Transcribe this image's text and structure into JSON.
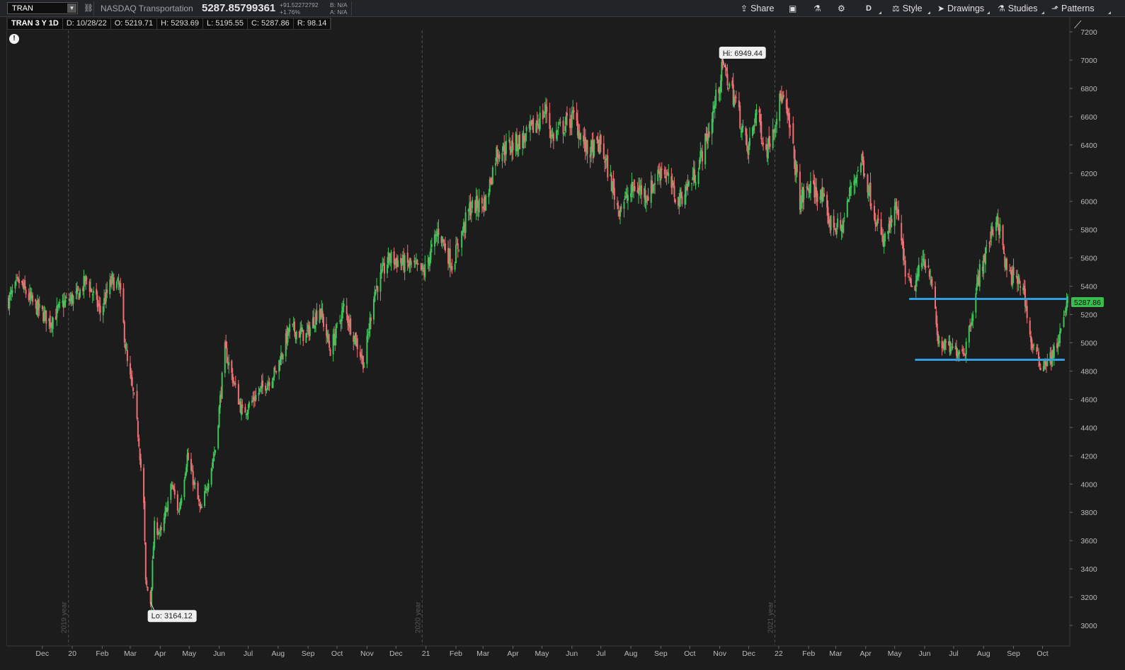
{
  "toolbar": {
    "symbol": "TRAN",
    "description": "NASDAQ Transportation",
    "last_price": "5287.85799361",
    "net_change": "+91.52272792",
    "pct_change": "+1.76%",
    "bid": "B: N/A",
    "ask": "A: N/A",
    "share_label": "Share",
    "aggregation_label": "D",
    "style_label": "Style",
    "drawings_label": "Drawings",
    "studies_label": "Studies",
    "patterns_label": "Patterns"
  },
  "infobar": {
    "symbol_period": "TRAN 3 Y 1D",
    "date": "D: 10/28/22",
    "open": "O: 5219.71",
    "high": "H: 5293.69",
    "low": "L: 5195.55",
    "close": "C: 5287.86",
    "range": "R: 98.14"
  },
  "colors": {
    "up": "#3ec45a",
    "down": "#ef6f74",
    "level_line": "#2f9fdf",
    "price_tag": "#3bbd4e"
  },
  "chart_data": {
    "type": "candlestick",
    "symbol": "TRAN",
    "ylim": [
      2900,
      7300
    ],
    "yticks": [
      3000,
      3200,
      3400,
      3600,
      3800,
      4000,
      4200,
      4400,
      4600,
      4800,
      5000,
      5200,
      5400,
      5600,
      5800,
      6000,
      6200,
      6400,
      6600,
      6800,
      7000,
      7200
    ],
    "x_labels": [
      "Dec",
      "20",
      "Feb",
      "Mar",
      "Apr",
      "May",
      "Jun",
      "Jul",
      "Aug",
      "Sep",
      "Oct",
      "Nov",
      "Dec",
      "21",
      "Feb",
      "Mar",
      "Apr",
      "May",
      "Jun",
      "Jul",
      "Aug",
      "Sep",
      "Oct",
      "Nov",
      "Dec",
      "22",
      "Feb",
      "Mar",
      "Apr",
      "May",
      "Jun",
      "Jul",
      "Aug",
      "Sep",
      "Oct"
    ],
    "year_separators": [
      {
        "date": "2020-01-01",
        "label": "2019 year"
      },
      {
        "date": "2021-01-01",
        "label": "2020 year"
      },
      {
        "date": "2022-01-01",
        "label": "2021 year"
      }
    ],
    "date_range": [
      "2019-10-28",
      "2022-10-28"
    ],
    "anchors": [
      [
        "2019-10-28",
        5300
      ],
      [
        "2019-11-08",
        5430
      ],
      [
        "2019-11-22",
        5280
      ],
      [
        "2019-12-10",
        5150
      ],
      [
        "2019-12-24",
        5280
      ],
      [
        "2020-01-07",
        5330
      ],
      [
        "2020-01-17",
        5450
      ],
      [
        "2020-01-31",
        5220
      ],
      [
        "2020-02-12",
        5440
      ],
      [
        "2020-02-20",
        5390
      ],
      [
        "2020-02-28",
        4850
      ],
      [
        "2020-03-06",
        4600
      ],
      [
        "2020-03-11",
        4300
      ],
      [
        "2020-03-16",
        3850
      ],
      [
        "2020-03-18",
        3300
      ],
      [
        "2020-03-23",
        3164
      ],
      [
        "2020-03-27",
        3700
      ],
      [
        "2020-04-03",
        3650
      ],
      [
        "2020-04-14",
        4000
      ],
      [
        "2020-04-21",
        3800
      ],
      [
        "2020-04-30",
        4200
      ],
      [
        "2020-05-14",
        3800
      ],
      [
        "2020-05-29",
        4250
      ],
      [
        "2020-06-08",
        4950
      ],
      [
        "2020-06-26",
        4500
      ],
      [
        "2020-07-13",
        4650
      ],
      [
        "2020-07-31",
        4800
      ],
      [
        "2020-08-14",
        5100
      ],
      [
        "2020-08-31",
        5050
      ],
      [
        "2020-09-14",
        5250
      ],
      [
        "2020-09-25",
        4950
      ],
      [
        "2020-10-09",
        5250
      ],
      [
        "2020-10-30",
        4850
      ],
      [
        "2020-11-09",
        5350
      ],
      [
        "2020-11-25",
        5600
      ],
      [
        "2020-12-15",
        5550
      ],
      [
        "2020-12-31",
        5500
      ],
      [
        "2021-01-15",
        5800
      ],
      [
        "2021-01-29",
        5550
      ],
      [
        "2021-02-16",
        5950
      ],
      [
        "2021-03-05",
        6000
      ],
      [
        "2021-03-16",
        6350
      ],
      [
        "2021-04-01",
        6400
      ],
      [
        "2021-04-15",
        6450
      ],
      [
        "2021-05-07",
        6650
      ],
      [
        "2021-05-12",
        6450
      ],
      [
        "2021-06-04",
        6600
      ],
      [
        "2021-06-18",
        6350
      ],
      [
        "2021-07-02",
        6400
      ],
      [
        "2021-07-20",
        5950
      ],
      [
        "2021-08-06",
        6100
      ],
      [
        "2021-08-20",
        6050
      ],
      [
        "2021-09-03",
        6250
      ],
      [
        "2021-09-20",
        6000
      ],
      [
        "2021-10-08",
        6200
      ],
      [
        "2021-10-22",
        6500
      ],
      [
        "2021-11-05",
        6949
      ],
      [
        "2021-11-19",
        6700
      ],
      [
        "2021-12-01",
        6350
      ],
      [
        "2021-12-10",
        6650
      ],
      [
        "2021-12-20",
        6350
      ],
      [
        "2022-01-05",
        6750
      ],
      [
        "2022-01-14",
        6500
      ],
      [
        "2022-01-24",
        6000
      ],
      [
        "2022-02-02",
        6100
      ],
      [
        "2022-02-14",
        6050
      ],
      [
        "2022-02-24",
        5850
      ],
      [
        "2022-03-08",
        5800
      ],
      [
        "2022-03-18",
        6100
      ],
      [
        "2022-03-29",
        6300
      ],
      [
        "2022-04-08",
        6000
      ],
      [
        "2022-04-20",
        5700
      ],
      [
        "2022-05-04",
        5950
      ],
      [
        "2022-05-12",
        5550
      ],
      [
        "2022-05-20",
        5350
      ],
      [
        "2022-06-01",
        5600
      ],
      [
        "2022-06-08",
        5500
      ],
      [
        "2022-06-16",
        5000
      ],
      [
        "2022-06-30",
        4950
      ],
      [
        "2022-07-14",
        4950
      ],
      [
        "2022-07-29",
        5500
      ],
      [
        "2022-08-16",
        5900
      ],
      [
        "2022-08-26",
        5500
      ],
      [
        "2022-09-12",
        5400
      ],
      [
        "2022-09-20",
        5000
      ],
      [
        "2022-09-30",
        4850
      ],
      [
        "2022-10-12",
        4900
      ],
      [
        "2022-10-20",
        5050
      ],
      [
        "2022-10-28",
        5287.86
      ]
    ],
    "hi_label": "Hi: 6949.44",
    "hi": {
      "date": "2021-11-05",
      "value": 6949.44
    },
    "lo_label": "Lo: 3164.12",
    "lo": {
      "date": "2020-03-23",
      "value": 3164.12
    },
    "levels": [
      {
        "value": 5310,
        "from": "2022-05-17",
        "to": "2022-10-28"
      },
      {
        "value": 4880,
        "from": "2022-05-23",
        "to": "2022-10-25"
      }
    ],
    "last_tag": "5287.86",
    "last_value": 5287.86
  }
}
